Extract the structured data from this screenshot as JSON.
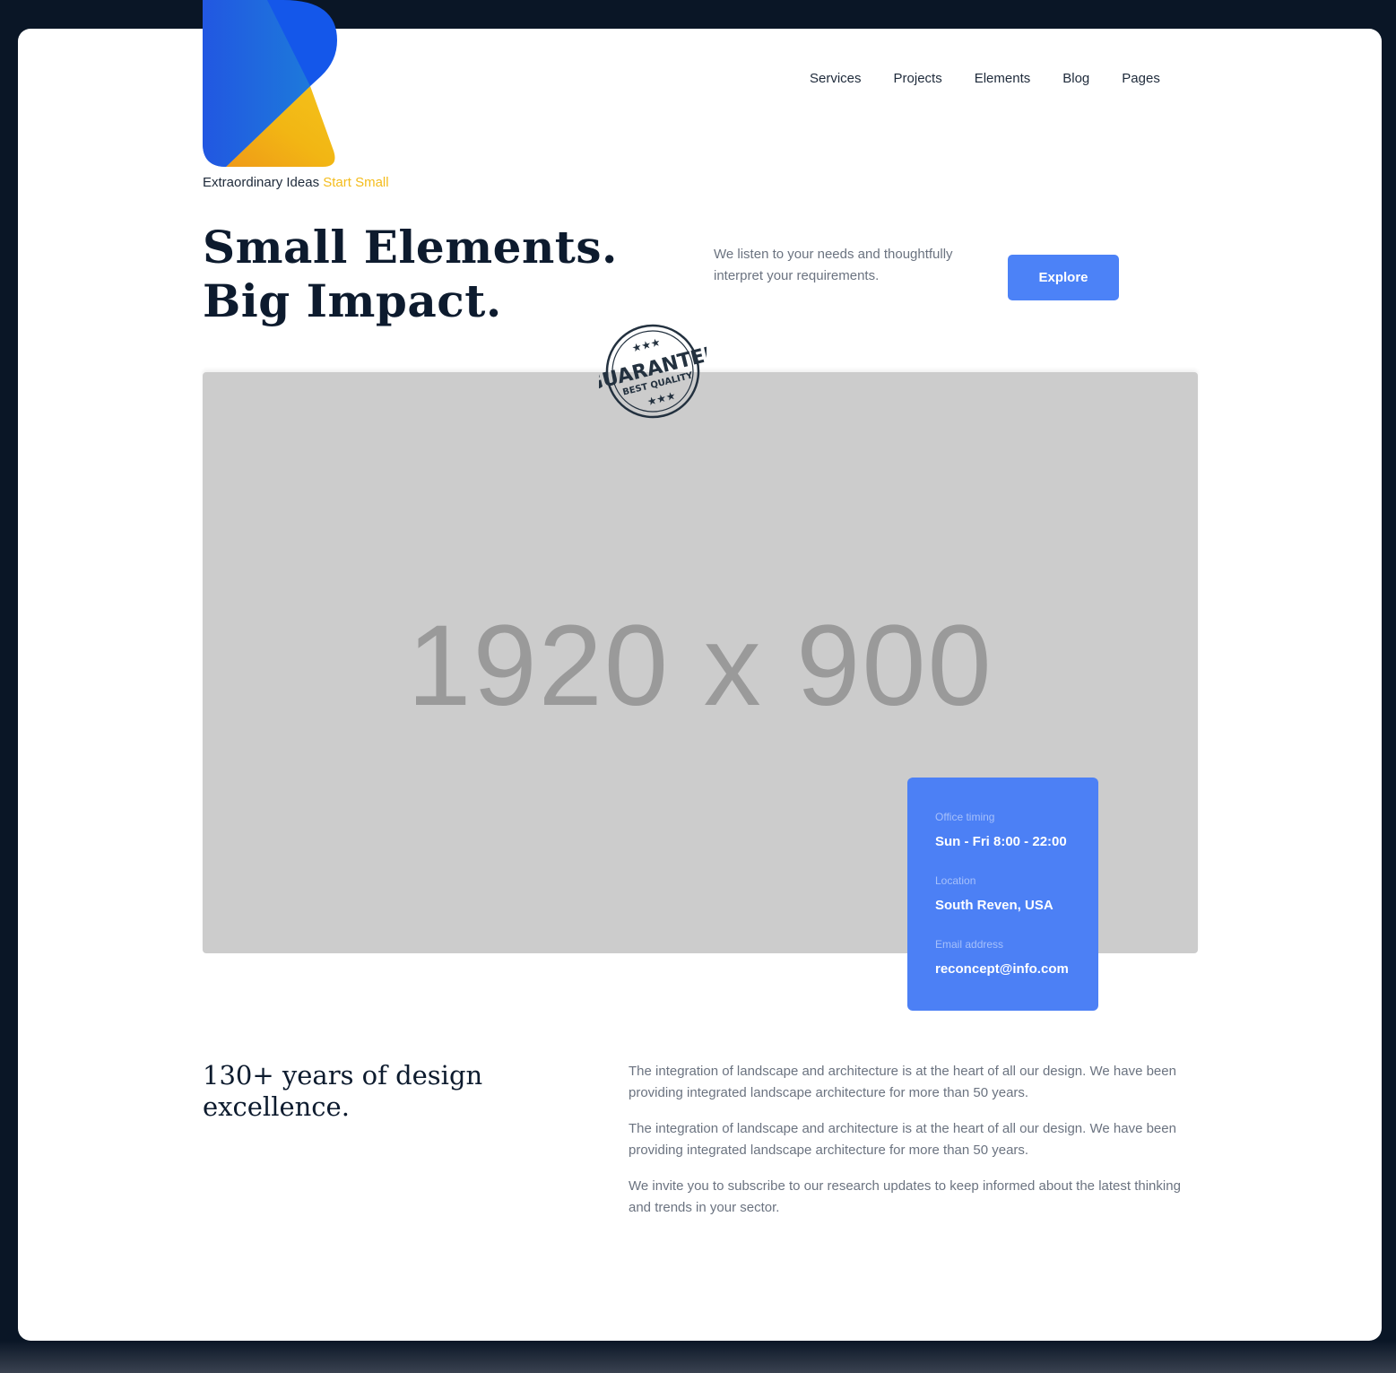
{
  "brand": {
    "tagline_prefix": "Extraordinary Ideas",
    "tagline_highlight": "Start Small",
    "accent": "#f4bc1c",
    "primary": "#4c82f7"
  },
  "nav": [
    "Services",
    "Projects",
    "Elements",
    "Blog",
    "Pages"
  ],
  "hero": {
    "title_line1": "Small Elements.",
    "title_line2": "Big Impact.",
    "lead": "We listen to your needs and thoughtfully interpret your requirements.",
    "cta": "Explore",
    "image_placeholder": "1920 x 900"
  },
  "stamp": {
    "text": "GUARANTEE",
    "subtext": "BEST QUALITY"
  },
  "info": {
    "items": [
      {
        "label": "Office timing",
        "value": "Sun - Fri 8:00 - 22:00"
      },
      {
        "label": "Location",
        "value": "South Reven, USA"
      },
      {
        "label": "Email address",
        "value": "reconcept@info.com"
      }
    ]
  },
  "about": {
    "heading": "130+ years of design excellence.",
    "paragraphs": [
      "The integration of landscape and architecture is at the heart of all our design. We have been providing integrated landscape architecture for more than 50 years.",
      "The integration of landscape and architecture is at the heart of all our design. We have been providing integrated landscape architecture for more than 50 years.",
      "We invite you to subscribe to our research updates to keep informed about the latest thinking and trends in your sector."
    ]
  }
}
